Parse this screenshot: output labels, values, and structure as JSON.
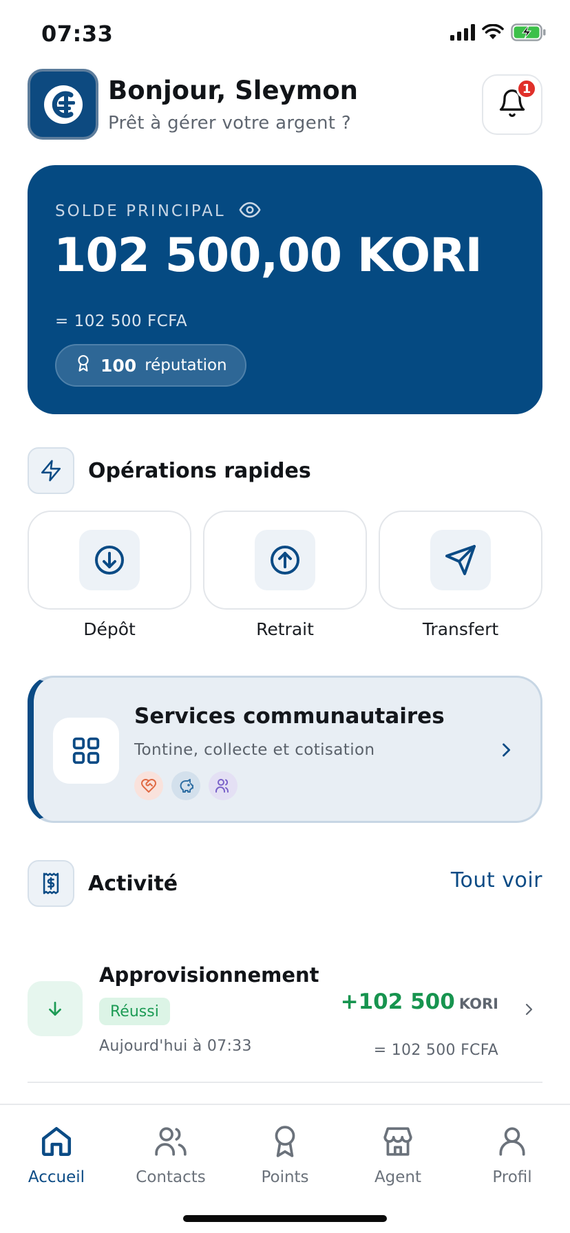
{
  "status_bar": {
    "time": "07:33",
    "icons": [
      "signal-icon",
      "wifi-icon",
      "battery-charging-icon"
    ]
  },
  "header": {
    "logo_icon": "kori-logo-icon",
    "greeting": "Bonjour, Sleymon",
    "subtitle": "Prêt à gérer votre argent ?",
    "notification_count": "1"
  },
  "balance": {
    "label": "SOLDE PRINCIPAL",
    "amount": "102 500,00 KORI",
    "fcfa": "= 102 500 FCFA",
    "reputation_value": "100",
    "reputation_label": "réputation"
  },
  "quick_ops": {
    "title": "Opérations rapides",
    "items": [
      {
        "label": "Dépôt",
        "icon": "arrow-down-circle-icon"
      },
      {
        "label": "Retrait",
        "icon": "arrow-up-circle-icon"
      },
      {
        "label": "Transfert",
        "icon": "send-icon"
      }
    ]
  },
  "services": {
    "title": "Services communautaires",
    "subtitle": "Tontine, collecte et cotisation",
    "icons": [
      "heart-handshake-icon",
      "piggy-bank-icon",
      "users-icon"
    ]
  },
  "activity": {
    "title": "Activité",
    "see_all": "Tout voir",
    "transactions": [
      {
        "title": "Approvisionnement",
        "status": "Réussi",
        "date": "Aujourd'hui à 07:33",
        "amount": "+102 500",
        "currency": "KORI",
        "fcfa": "= 102 500 FCFA"
      }
    ]
  },
  "nav": {
    "items": [
      {
        "label": "Accueil",
        "icon": "home-icon",
        "active": true
      },
      {
        "label": "Contacts",
        "icon": "contacts-icon",
        "active": false
      },
      {
        "label": "Points",
        "icon": "award-icon",
        "active": false
      },
      {
        "label": "Agent",
        "icon": "store-icon",
        "active": false
      },
      {
        "label": "Profil",
        "icon": "user-icon",
        "active": false
      }
    ]
  },
  "colors": {
    "primary": "#054a82",
    "accent": "#0b4b85",
    "success": "#17944f",
    "badge": "#e0302a"
  }
}
